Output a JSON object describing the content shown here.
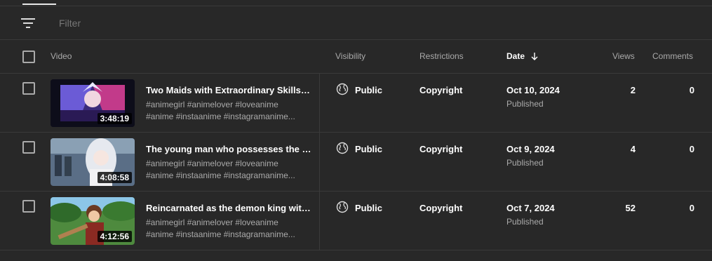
{
  "filter": {
    "placeholder": "Filter"
  },
  "columns": {
    "video": "Video",
    "visibility": "Visibility",
    "restrictions": "Restrictions",
    "date": "Date",
    "views": "Views",
    "comments": "Comments"
  },
  "rows": [
    {
      "title": "Two Maids with Extraordinary Skills in ...",
      "desc1": "#animegirl #animelover #loveanime",
      "desc2": "#anime #instaanime #instagramanime...",
      "duration": "3:48:19",
      "visibility": "Public",
      "restriction": "Copyright",
      "date": "Oct 10, 2024",
      "status": "Published",
      "views": "2",
      "comments": "0"
    },
    {
      "title": "The young man who possesses the st...",
      "desc1": "#animegirl #animelover #loveanime",
      "desc2": "#anime #instaanime #instagramanime...",
      "duration": "4:08:58",
      "visibility": "Public",
      "restriction": "Copyright",
      "date": "Oct 9, 2024",
      "status": "Published",
      "views": "4",
      "comments": "0"
    },
    {
      "title": "Reincarnated as the demon king with t...",
      "desc1": "#animegirl #animelover #loveanime",
      "desc2": "#anime #instaanime #instagramanime...",
      "duration": "4:12:56",
      "visibility": "Public",
      "restriction": "Copyright",
      "date": "Oct 7, 2024",
      "status": "Published",
      "views": "52",
      "comments": "0"
    }
  ],
  "icons": {
    "filter": "filter-icon",
    "globe": "globe-icon",
    "sort": "arrow-down-icon"
  },
  "colors": {
    "background": "#282828",
    "border": "#3a3a3a",
    "secondary_text": "#aaaaaa"
  }
}
